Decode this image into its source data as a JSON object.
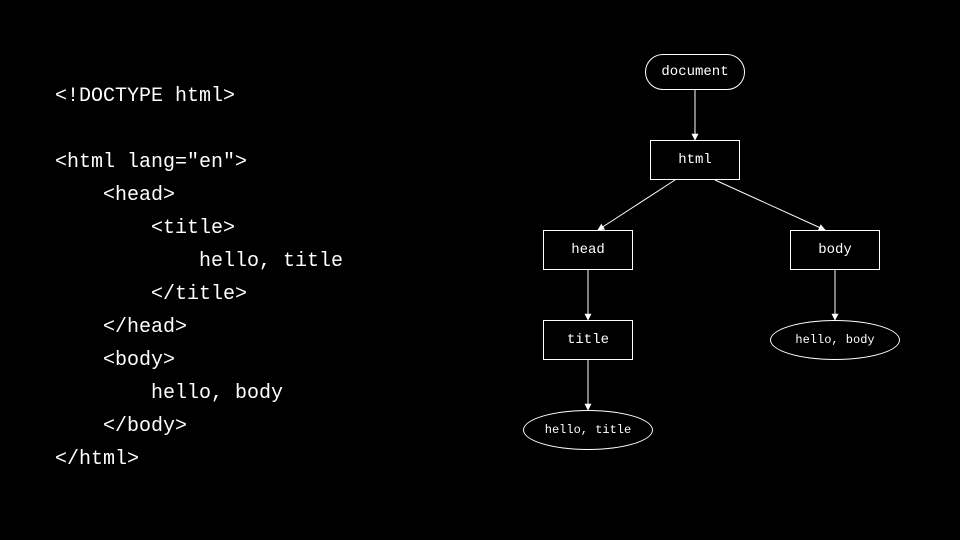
{
  "code": {
    "l1": "<!DOCTYPE html>",
    "l2": "",
    "l3": "<html lang=\"en\">",
    "l4": "    <head>",
    "l5": "        <title>",
    "l6": "            hello, title",
    "l7": "        </title>",
    "l8": "    </head>",
    "l9": "    <body>",
    "l10": "        hello, body",
    "l11": "    </body>",
    "l12": "</html>"
  },
  "diagram": {
    "nodes": {
      "document": "document",
      "html": "html",
      "head": "head",
      "body": "body",
      "title": "title",
      "hello_title": "hello, title",
      "hello_body": "hello, body"
    }
  }
}
